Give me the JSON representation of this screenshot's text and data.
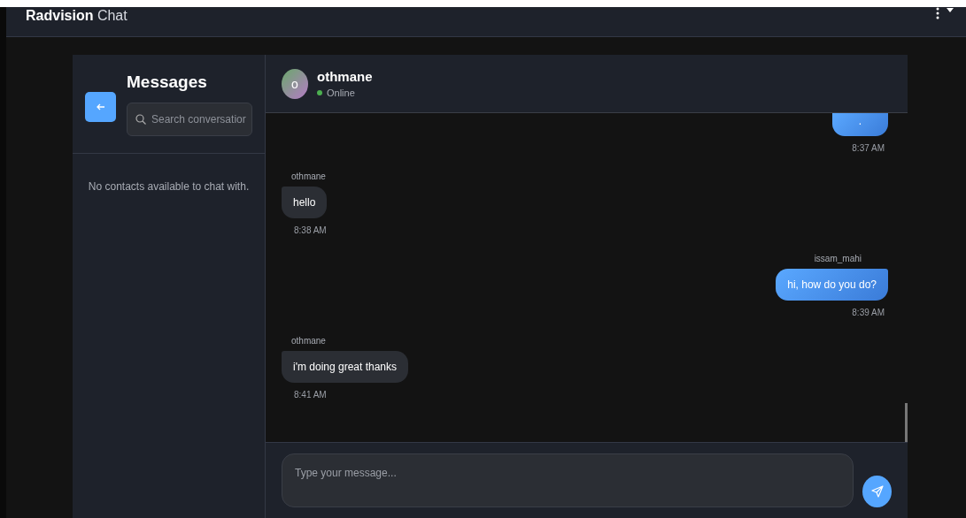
{
  "app_bar": {
    "brand": "**Radvision** Chat"
  },
  "sidebar": {
    "title": "Messages",
    "search": {
      "placeholder": "Search conversatior"
    },
    "empty_text": "No contacts available to chat with."
  },
  "chat": {
    "contact": {
      "name": "othmane",
      "initial": "o",
      "status": "Online",
      "online": true
    },
    "messages": [
      {
        "mine": true,
        "text": ".",
        "time": "8:37 AM"
      },
      {
        "mine": false,
        "sender": "othmane",
        "text": "hello",
        "time": "8:38 AM"
      },
      {
        "mine": true,
        "sender": "issam_mahi",
        "text": "hi, how do you do?",
        "time": "8:39 AM"
      },
      {
        "mine": false,
        "sender": "othmane",
        "text": "i'm doing great thanks",
        "time": "8:41 AM"
      }
    ],
    "composer": {
      "placeholder": "Type your message..."
    }
  }
}
